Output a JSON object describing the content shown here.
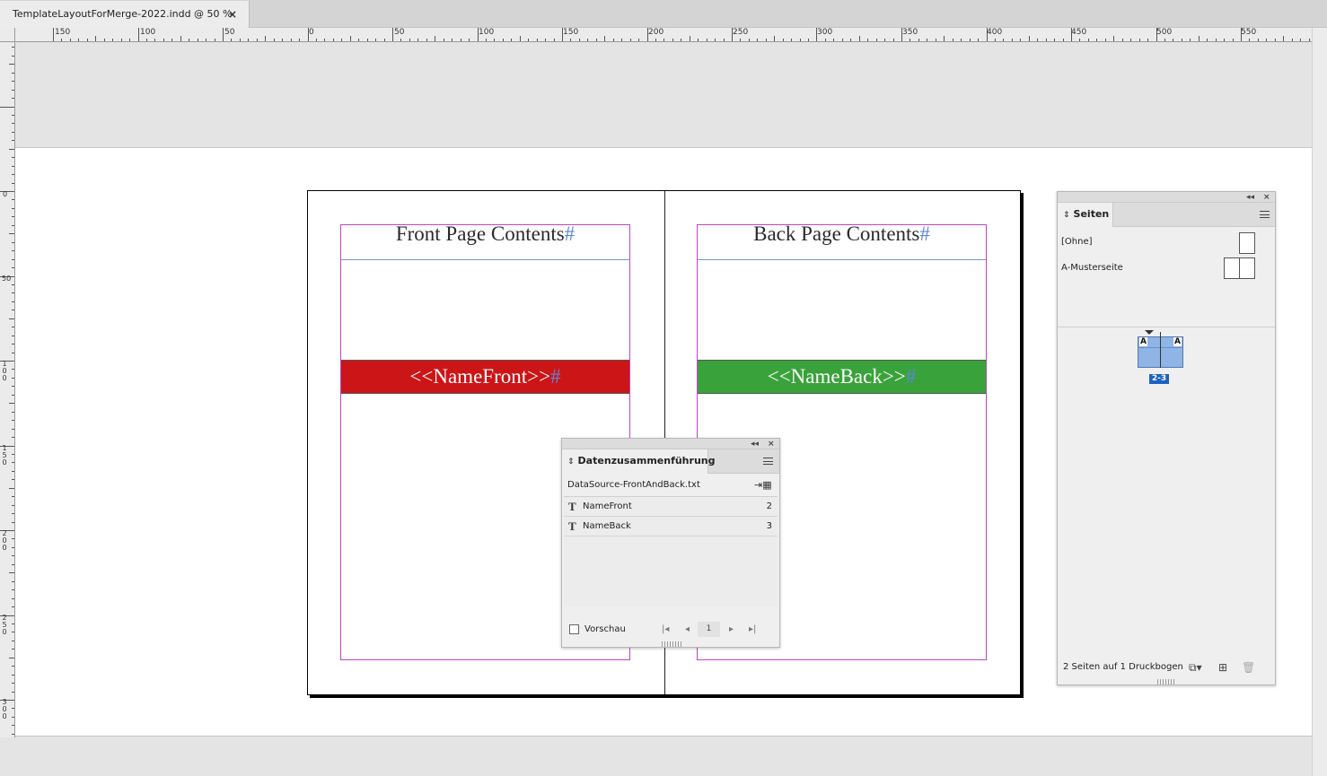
{
  "tab": {
    "title": "TemplateLayoutForMerge-2022.indd @ 50 %",
    "close": "×"
  },
  "ruler": {
    "h_labels": [
      "150",
      "100",
      "50",
      "0",
      "50",
      "100",
      "150",
      "200",
      "250",
      "300",
      "350",
      "400",
      "450",
      "500",
      "550"
    ],
    "v_labels": [
      "0",
      "50",
      "100",
      "150",
      "200",
      "250",
      "300"
    ]
  },
  "spread": {
    "left_heading": "Front Page Contents",
    "right_heading": "Back Page Contents",
    "left_name": "<<NameFront>>",
    "right_name": "<<NameBack>>",
    "hash": "#",
    "colors": {
      "name_front_bar": "#cc1517",
      "name_back_bar": "#3aa23a",
      "margin_guide": "#c243c2"
    }
  },
  "data_merge": {
    "collapse": "◂◂",
    "close": "×",
    "title": "Datenzusammenführung",
    "tab_arrows": "⇕",
    "source": "DataSource-FrontAndBack.txt",
    "fields": [
      {
        "icon": "T",
        "name": "NameFront",
        "page": "2"
      },
      {
        "icon": "T",
        "name": "NameBack",
        "page": "3"
      }
    ],
    "preview_label": "Vorschau",
    "record": "1",
    "nav": {
      "first": "|◂",
      "prev": "◂",
      "next": "▸",
      "last": "▸|"
    }
  },
  "pages": {
    "collapse": "◂◂",
    "close": "×",
    "title": "Seiten",
    "tab_arrows": "⇕",
    "parent_none": "[Ohne]",
    "parent_a": "A-Musterseite",
    "spread_label_left": "A",
    "spread_label_right": "A",
    "spread_number": "2-3",
    "footer": "2 Seiten auf 1 Druckbogen"
  }
}
